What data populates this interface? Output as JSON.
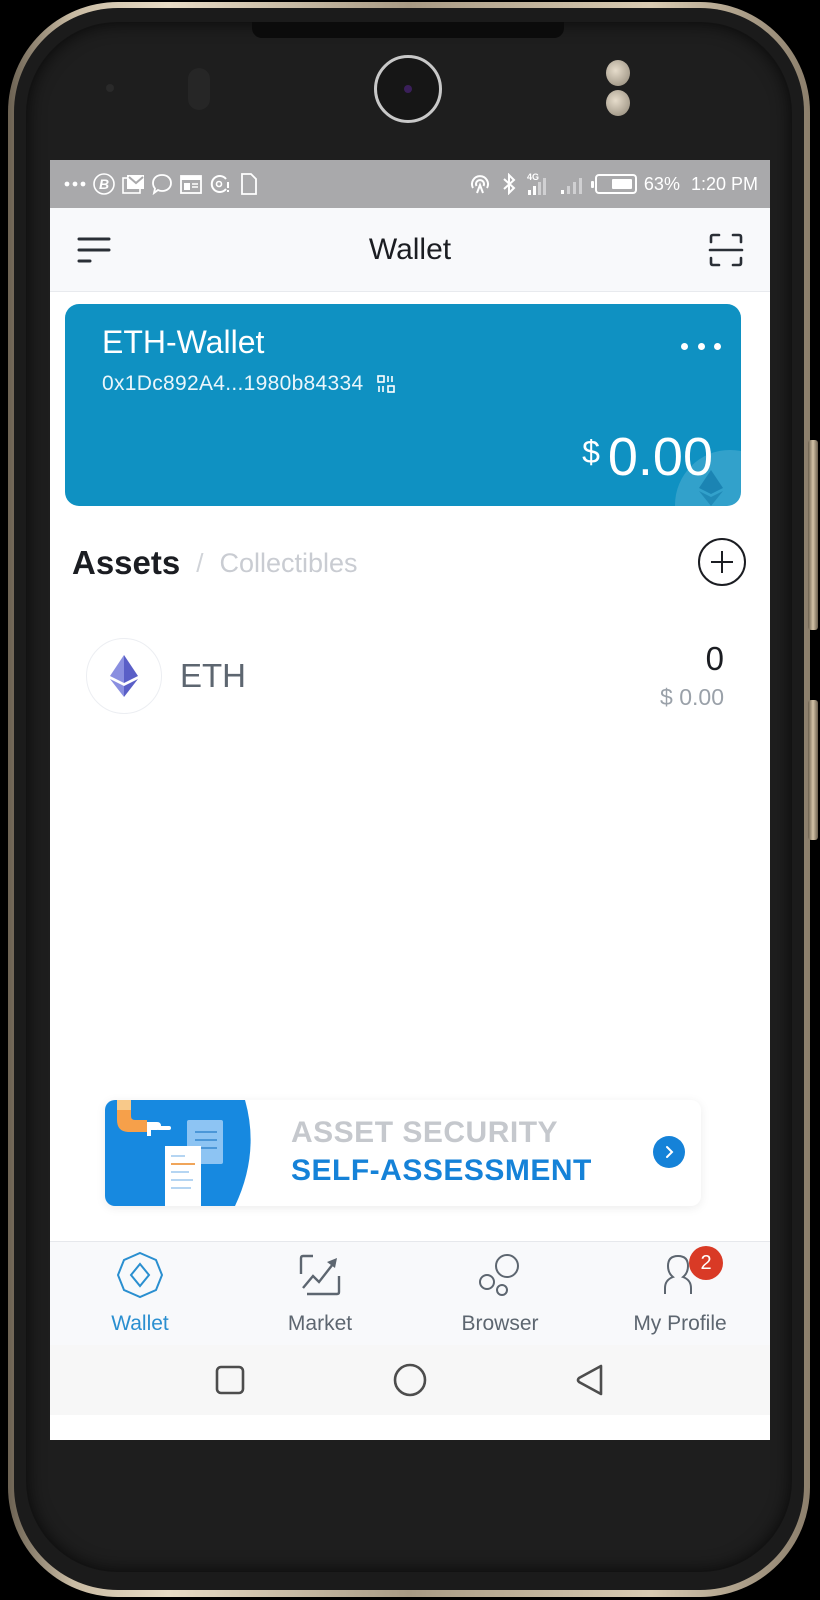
{
  "status_bar": {
    "left_icons": [
      "more-notifications-icon",
      "b-app-icon",
      "gallery-mail-icon",
      "chat-icon",
      "calendar-icon",
      "sync-alert-icon",
      "file-icon"
    ],
    "right_icons": [
      "hotspot-icon",
      "bluetooth-icon",
      "signal-4g-icon",
      "signal-icon"
    ],
    "network_label": "4G",
    "battery_percent": 63,
    "battery_text": "63%",
    "time": "1:20 PM"
  },
  "header": {
    "title": "Wallet",
    "menu_icon": "menu-icon",
    "scan_icon": "scan-icon"
  },
  "wallet_card": {
    "name": "ETH-Wallet",
    "address": "0x1Dc892A4...1980b84334",
    "currency_symbol": "$",
    "balance": "0.00",
    "color": "#0f91c2"
  },
  "assets": {
    "tabs": [
      {
        "label": "Assets",
        "active": true
      },
      {
        "label": "Collectibles",
        "active": false
      }
    ],
    "separator": "/",
    "items": [
      {
        "symbol": "ETH",
        "amount": "0",
        "fiat_value": "$ 0.00"
      }
    ]
  },
  "banner": {
    "line1": "ASSET SECURITY",
    "line2": "SELF-ASSESSMENT",
    "accent": "#1582d8"
  },
  "bottom_nav": {
    "items": [
      {
        "label": "Wallet",
        "icon": "wallet-icon",
        "active": true
      },
      {
        "label": "Market",
        "icon": "market-chart-icon",
        "active": false
      },
      {
        "label": "Browser",
        "icon": "browser-bubbles-icon",
        "active": false
      },
      {
        "label": "My Profile",
        "icon": "profile-icon",
        "active": false,
        "badge": "2"
      }
    ],
    "active_color": "#2a8fd0"
  },
  "system_nav": [
    "recent-apps",
    "home",
    "back"
  ]
}
